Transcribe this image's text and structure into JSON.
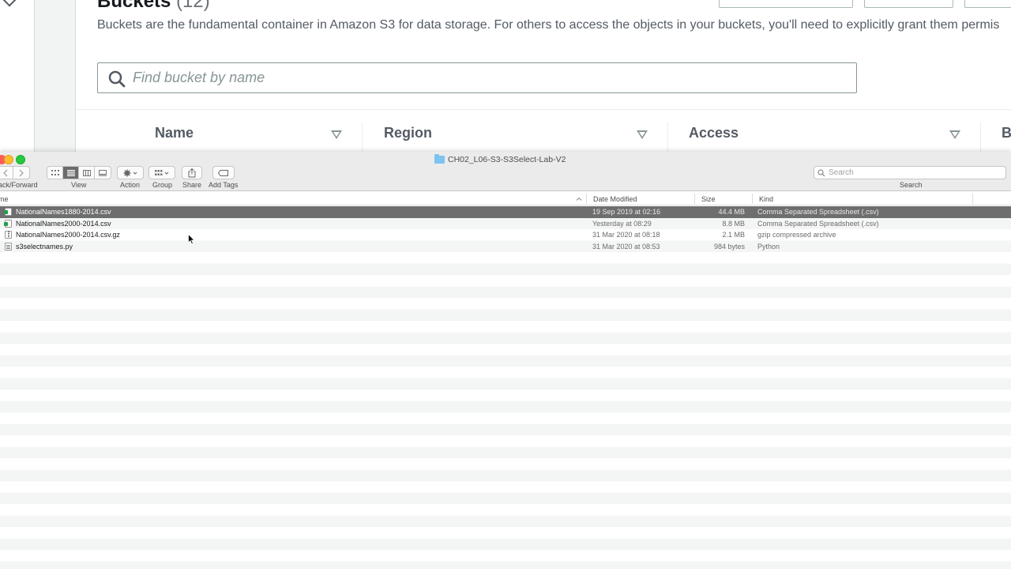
{
  "s3": {
    "title": "Buckets",
    "count": "(12)",
    "description": "Buckets are the fundamental container in Amazon S3 for data storage. For others to access the objects in your buckets, you'll need to explicitly grant them permis",
    "search_placeholder": "Find bucket by name",
    "columns": [
      "Name",
      "Region",
      "Access",
      "B"
    ]
  },
  "finder": {
    "window_title": "CH02_L06-S3-S3Select-Lab-V2",
    "toolbar": {
      "back_forward_label": "ack/Forward",
      "view_label": "View",
      "action_label": "Action",
      "group_label": "Group",
      "share_label": "Share",
      "add_tags_label": "Add Tags",
      "search_label": "Search",
      "search_placeholder": "Search"
    },
    "columns": {
      "name": "me",
      "date_modified": "Date Modified",
      "size": "Size",
      "kind": "Kind"
    },
    "files": [
      {
        "name": "NationalNames1880-2014.csv",
        "date": "19 Sep 2019 at 02:16",
        "size": "44.4 MB",
        "kind": "Comma Separated Spreadsheet (.csv)",
        "icon": "csv-file-icon",
        "selected": true
      },
      {
        "name": "NationalNames2000-2014.csv",
        "date": "Yesterday at 08:29",
        "size": "8.8 MB",
        "kind": "Comma Separated Spreadsheet (.csv)",
        "icon": "csv-file-icon",
        "selected": false
      },
      {
        "name": "NationalNames2000-2014.csv.gz",
        "date": "31 Mar 2020 at 08:18",
        "size": "2.1 MB",
        "kind": "gzip compressed archive",
        "icon": "archive-file-icon",
        "selected": false
      },
      {
        "name": "s3selectnames.py",
        "date": "31 Mar 2020 at 08:53",
        "size": "984 bytes",
        "kind": "Python",
        "icon": "python-file-icon",
        "selected": false
      }
    ]
  },
  "colors": {
    "selected_row": "#6e6e6e",
    "traffic_red": "#fc5f57",
    "traffic_yellow": "#fdbc2e",
    "traffic_green": "#28c840",
    "folder": "#7ec3ef"
  }
}
